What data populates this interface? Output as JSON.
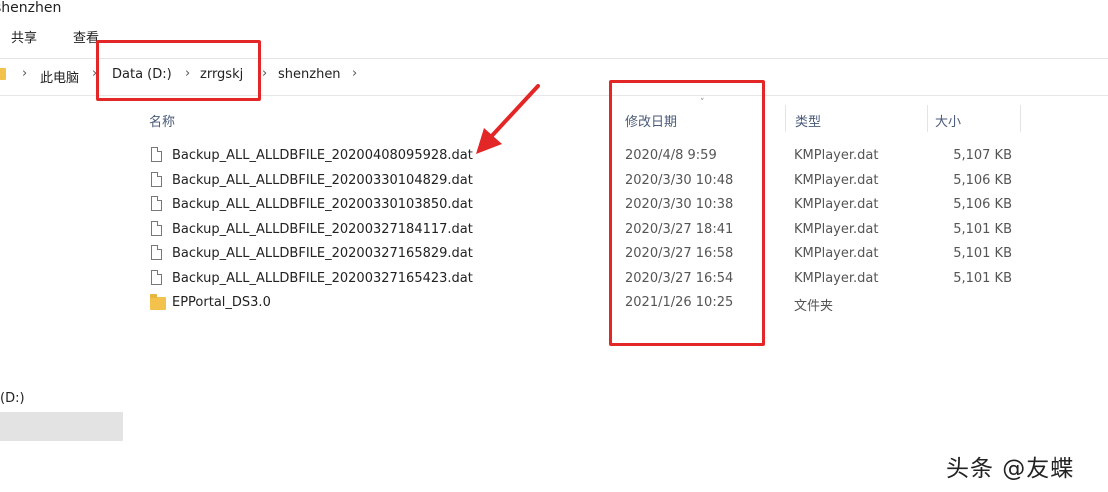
{
  "window": {
    "title": "shenzhen"
  },
  "ribbon": {
    "share": "共享",
    "view": "查看"
  },
  "breadcrumb": {
    "items": [
      "此电脑",
      "Data (D:)",
      "zrrgskj",
      "shenzhen"
    ],
    "separator": "›"
  },
  "columns": {
    "name": "名称",
    "date": "修改日期",
    "type": "类型",
    "size": "大小"
  },
  "files": [
    {
      "name": "Backup_ALL_ALLDBFILE_20200408095928.dat",
      "date": "2020/4/8 9:59",
      "type": "KMPlayer.dat",
      "size": "5,107 KB",
      "icon": "file-icon"
    },
    {
      "name": "Backup_ALL_ALLDBFILE_20200330104829.dat",
      "date": "2020/3/30 10:48",
      "type": "KMPlayer.dat",
      "size": "5,106 KB",
      "icon": "file-icon"
    },
    {
      "name": "Backup_ALL_ALLDBFILE_20200330103850.dat",
      "date": "2020/3/30 10:38",
      "type": "KMPlayer.dat",
      "size": "5,106 KB",
      "icon": "file-icon"
    },
    {
      "name": "Backup_ALL_ALLDBFILE_20200327184117.dat",
      "date": "2020/3/27 18:41",
      "type": "KMPlayer.dat",
      "size": "5,101 KB",
      "icon": "file-icon"
    },
    {
      "name": "Backup_ALL_ALLDBFILE_20200327165829.dat",
      "date": "2020/3/27 16:58",
      "type": "KMPlayer.dat",
      "size": "5,101 KB",
      "icon": "file-icon"
    },
    {
      "name": "Backup_ALL_ALLDBFILE_20200327165423.dat",
      "date": "2020/3/27 16:54",
      "type": "KMPlayer.dat",
      "size": "5,101 KB",
      "icon": "file-icon"
    },
    {
      "name": "EPPortal_DS3.0",
      "date": "2021/1/26 10:25",
      "type": "文件夹",
      "size": "",
      "icon": "folder-icon"
    }
  ],
  "sidebar": {
    "drive_label": "(D:)"
  },
  "watermark": "头条 @友蝶",
  "colors": {
    "annotation": "#e32626",
    "folder": "#f2c24c",
    "selection": "#e3e3e3"
  }
}
